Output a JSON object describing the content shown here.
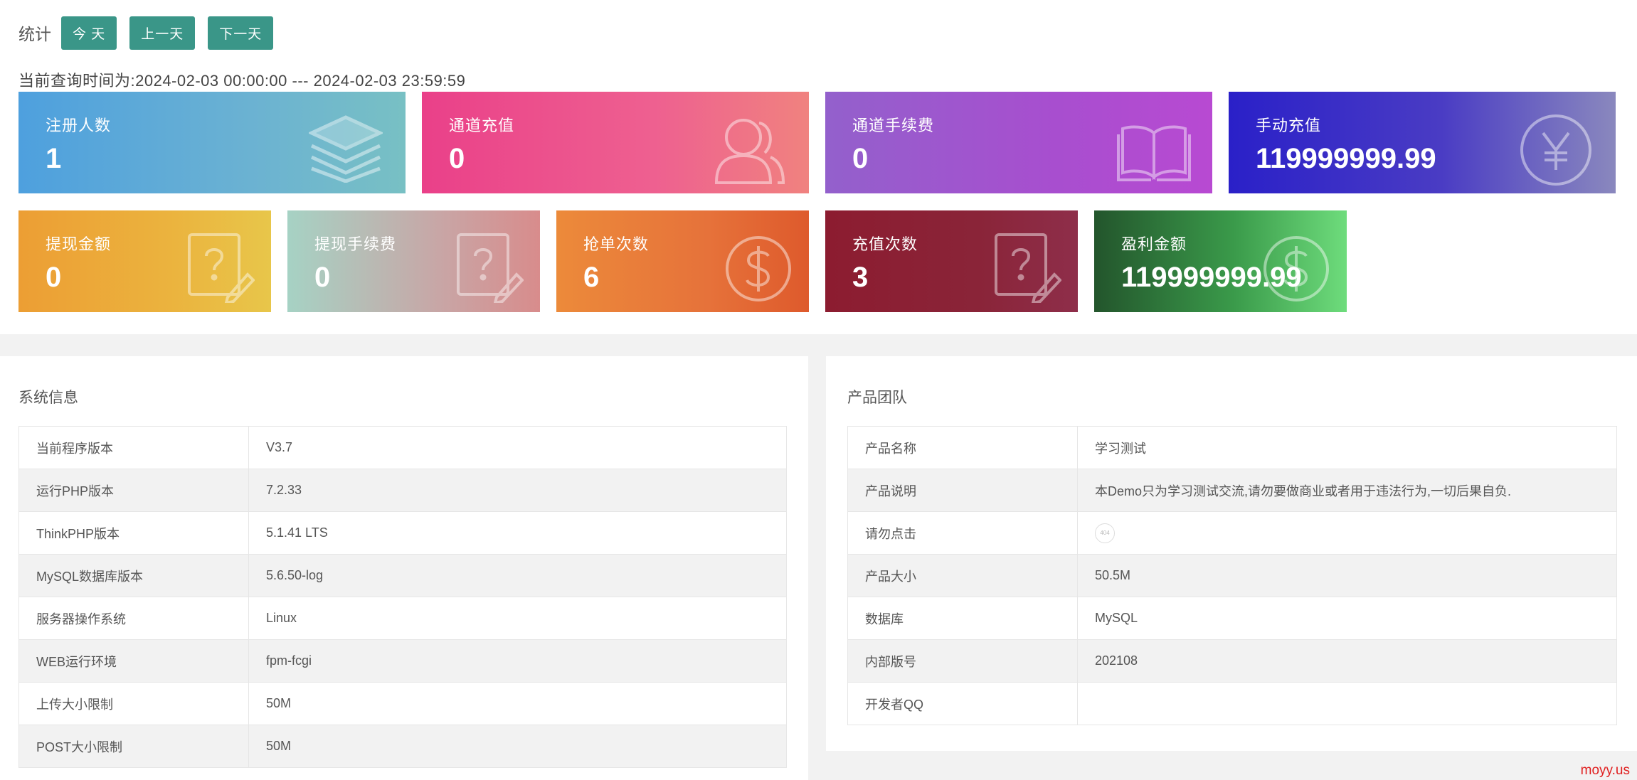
{
  "toolbar": {
    "label": "统计",
    "today": "今 天",
    "prev": "上一天",
    "next": "下一天"
  },
  "query_time": "当前查询时间为:2024-02-03 00:00:00 --- 2024-02-03 23:59:59",
  "cards": {
    "register": {
      "title": "注册人数",
      "value": "1",
      "icon": "layers-icon"
    },
    "channel_recharge": {
      "title": "通道充值",
      "value": "0",
      "icon": "users-icon"
    },
    "channel_fee": {
      "title": "通道手续费",
      "value": "0",
      "icon": "book-icon"
    },
    "manual_recharge": {
      "title": "手动充值",
      "value": "119999999.99",
      "icon": "yen-icon"
    },
    "withdraw_amount": {
      "title": "提现金额",
      "value": "0",
      "icon": "question-edit-icon"
    },
    "withdraw_fee": {
      "title": "提现手续费",
      "value": "0",
      "icon": "question-edit-icon"
    },
    "grab_count": {
      "title": "抢单次数",
      "value": "6",
      "icon": "dollar-icon"
    },
    "recharge_count": {
      "title": "充值次数",
      "value": "3",
      "icon": "question-edit-icon"
    },
    "profit": {
      "title": "盈利金额",
      "value": "119999999.99",
      "icon": "dollar-icon"
    }
  },
  "system_info": {
    "title": "系统信息",
    "rows": [
      {
        "k": "当前程序版本",
        "v": "V3.7"
      },
      {
        "k": "运行PHP版本",
        "v": "7.2.33"
      },
      {
        "k": "ThinkPHP版本",
        "v": "5.1.41 LTS"
      },
      {
        "k": "MySQL数据库版本",
        "v": "5.6.50-log"
      },
      {
        "k": "服务器操作系统",
        "v": "Linux"
      },
      {
        "k": "WEB运行环境",
        "v": "fpm-fcgi"
      },
      {
        "k": "上传大小限制",
        "v": "50M"
      },
      {
        "k": "POST大小限制",
        "v": "50M"
      }
    ]
  },
  "product_team": {
    "title": "产品团队",
    "rows": [
      {
        "k": "产品名称",
        "v": "学习测试"
      },
      {
        "k": "产品说明",
        "v": "本Demo只为学习测试交流,请勿要做商业或者用于违法行为,一切后果自负."
      },
      {
        "k": "请勿点击",
        "v": ""
      },
      {
        "k": "产品大小",
        "v": "50.5M"
      },
      {
        "k": "数据库",
        "v": "MySQL"
      },
      {
        "k": "内部版号",
        "v": "202108"
      },
      {
        "k": "开发者QQ",
        "v": ""
      }
    ],
    "badge_text": "404"
  },
  "watermark": "moyy.us"
}
